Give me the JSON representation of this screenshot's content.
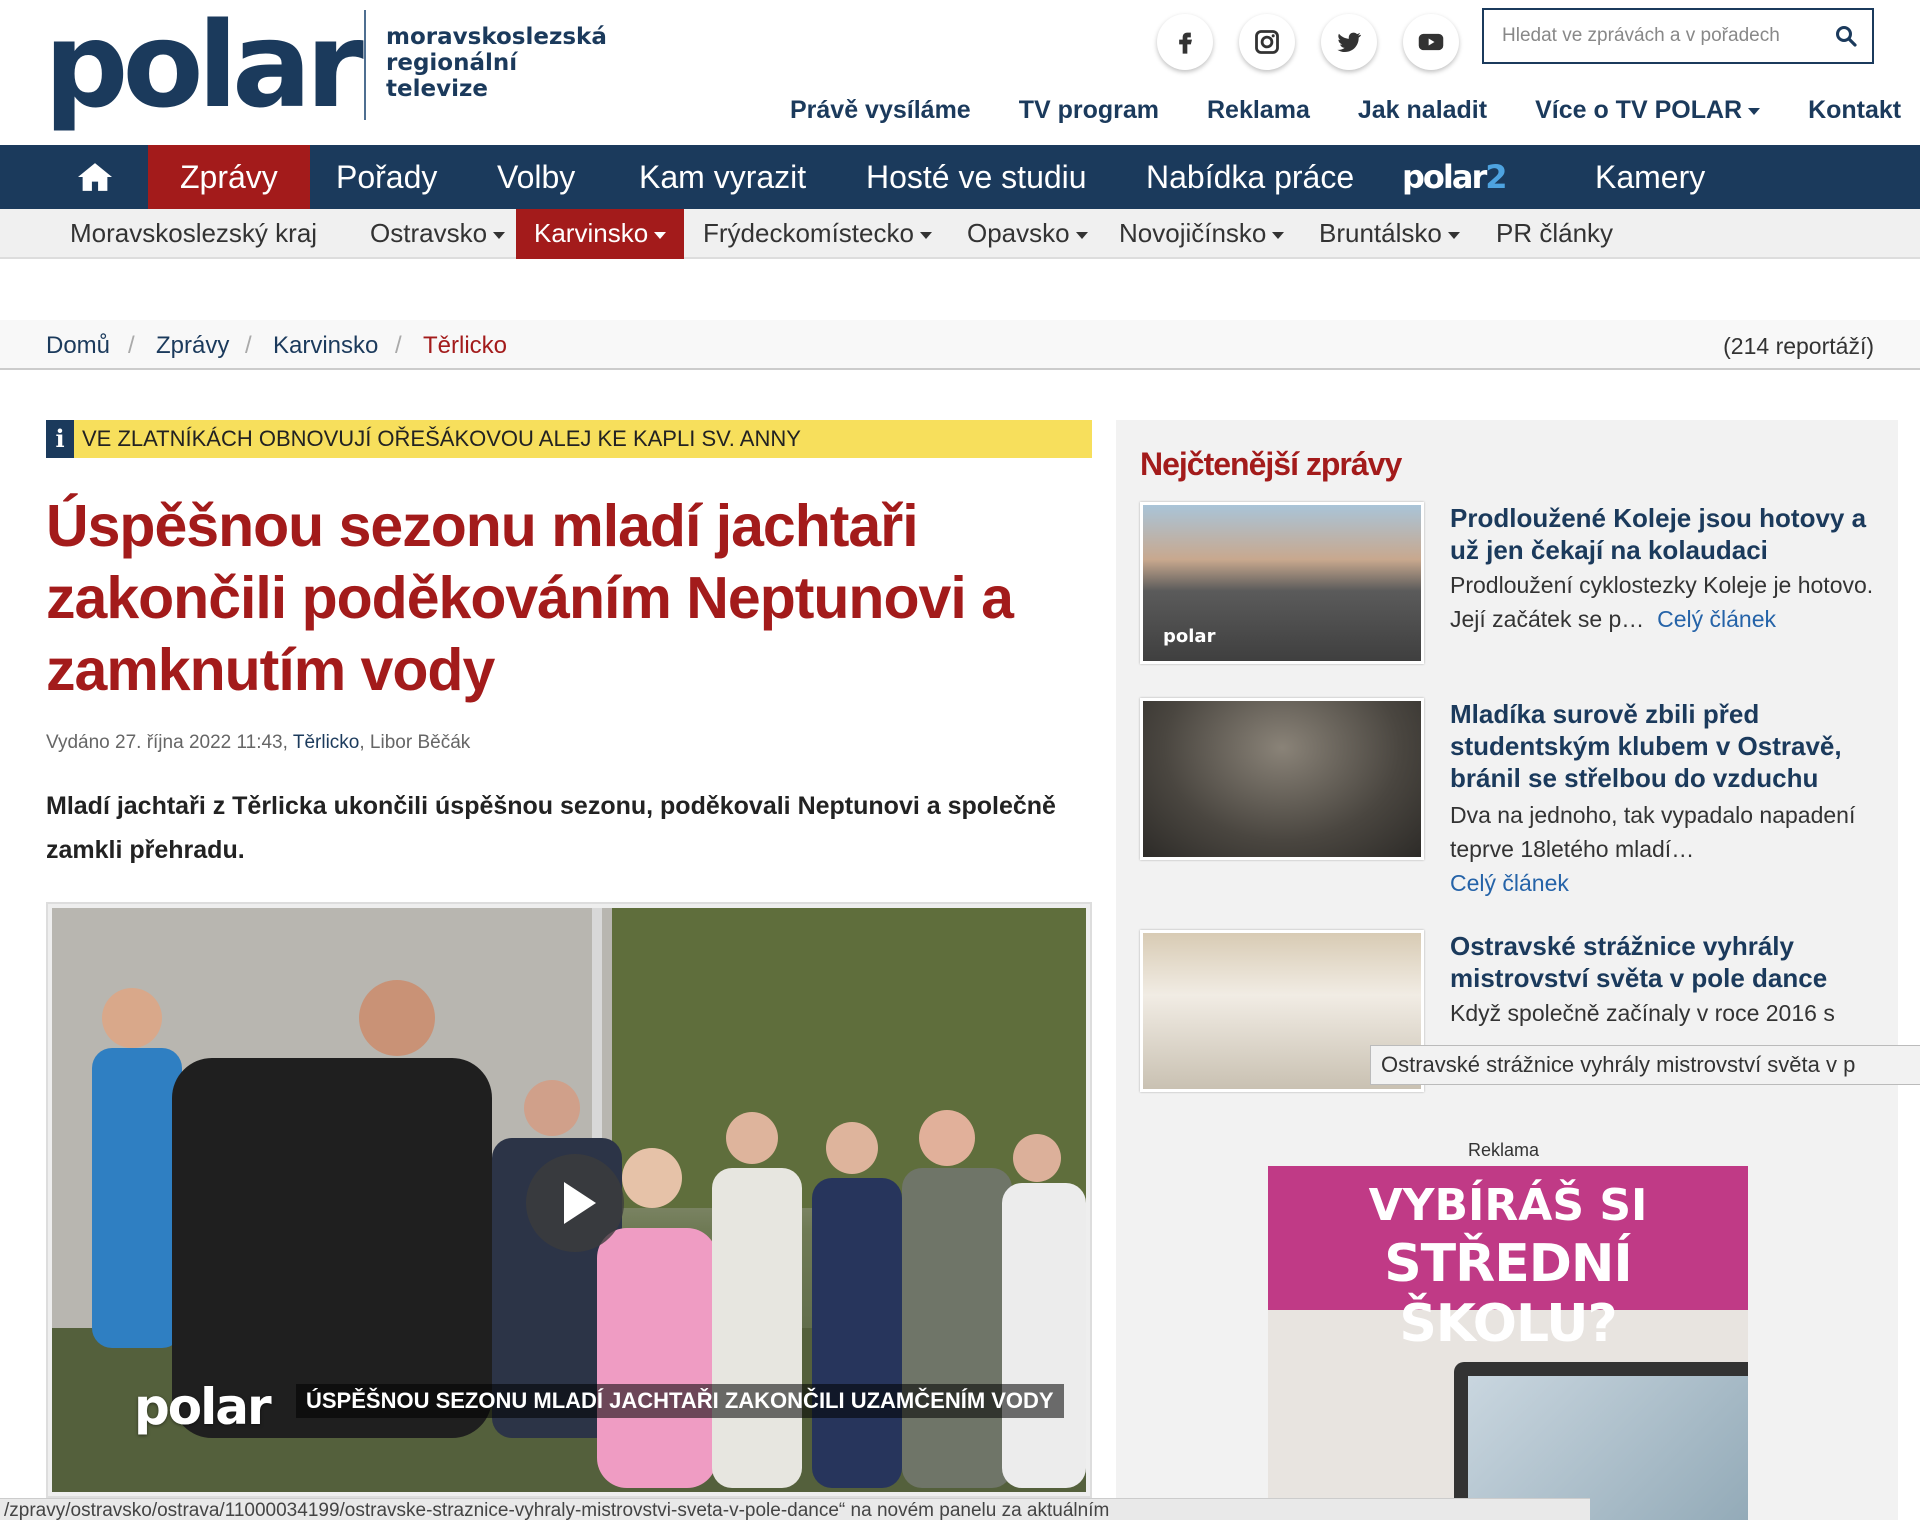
{
  "brand": {
    "logo": "polar",
    "subtitle": "moravskoslezská regionální televize"
  },
  "social": [
    "facebook-icon",
    "instagram-icon",
    "twitter-icon",
    "youtube-icon"
  ],
  "search": {
    "placeholder": "Hledat ve zprávách a v pořadech"
  },
  "topnav": [
    "Právě vysíláme",
    "TV program",
    "Reklama",
    "Jak naladit",
    "Více o TV POLAR",
    "Kontakt"
  ],
  "mainnav": {
    "zpravy": "Zprávy",
    "porady": "Pořady",
    "volby": "Volby",
    "kam": "Kam vyrazit",
    "hoste": "Hosté ve studiu",
    "prace": "Nabídka práce",
    "polar2_a": "polar",
    "polar2_b": "2",
    "kamery": "Kamery"
  },
  "subnav": [
    "Moravskoslezský kraj",
    "Ostravsko",
    "Karvinsko",
    "Frýdeckomístecko",
    "Opavsko",
    "Novojičínsko",
    "Bruntálsko",
    "PR články"
  ],
  "breadcrumb": {
    "items": [
      "Domů",
      "Zprávy",
      "Karvinsko",
      "Těrlicko"
    ],
    "separator": "/",
    "count": "(214 reportáží)"
  },
  "info": {
    "icon": "i",
    "text": "VE ZLATNÍKÁCH OBNOVUJÍ OŘEŠÁKOVOU ALEJ KE KAPLI SV. ANNY"
  },
  "article": {
    "title": "Úspěšnou sezonu mladí jachtaři zakončili poděkováním Neptunovi a zamknutím vody",
    "meta_prefix": "Vydáno 27. října 2022 11:43,",
    "meta_location": "Těrlicko",
    "meta_author": ", Libor Běčák",
    "lead": "Mladí jachtaři z Těrlicka ukončili úspěšnou sezonu, poděkovali Neptunovi a společně zamkli přehradu.",
    "video_logo": "polar",
    "video_caption": "ÚSPĚŠNOU SEZONU MLADÍ JACHTAŘI ZAKONČILI UZAMČENÍM VODY"
  },
  "sidebar": {
    "title": "Nejčtenější zprávy",
    "cards": [
      {
        "title": "Prodloužené Koleje jsou hotovy a už jen čekají na kolaudaci",
        "desc": "Prodloužení cyklostezky Koleje je hotovo. Její začátek se p…",
        "more": "Celý článek",
        "thumb_logo": "polar"
      },
      {
        "title": "Mladíka surově zbili před studentským klubem v Ostravě, bránil se střelbou do vzduchu",
        "desc": "Dva na jednoho, tak vypadalo napadení teprve 18letého mladí…",
        "more": "Celý článek",
        "thumb_logo": ""
      },
      {
        "title": "Ostravské strážnice vyhrály mistrovství světa v pole dance",
        "desc": "Když společně začínaly v roce 2016 s",
        "more": "",
        "thumb_logo": ""
      }
    ]
  },
  "tooltip": "Ostravské strážnice vyhrály mistrovství světa v p",
  "ad": {
    "label": "Reklama",
    "line1": "VYBÍRÁŠ SI",
    "line2": "STŘEDNÍ ŠKOLU?"
  },
  "statusbar": "/zpravy/ostravsko/ostrava/11000034199/ostravske-straznice-vyhraly-mistrovstvi-sveta-v-pole-dance“ na novém panelu za aktuálním",
  "colors": {
    "navy": "#1b3a5c",
    "red": "#a31b1b",
    "yellow": "#f7df5c",
    "link": "#2563a8",
    "ad_pink": "#c03a86"
  }
}
